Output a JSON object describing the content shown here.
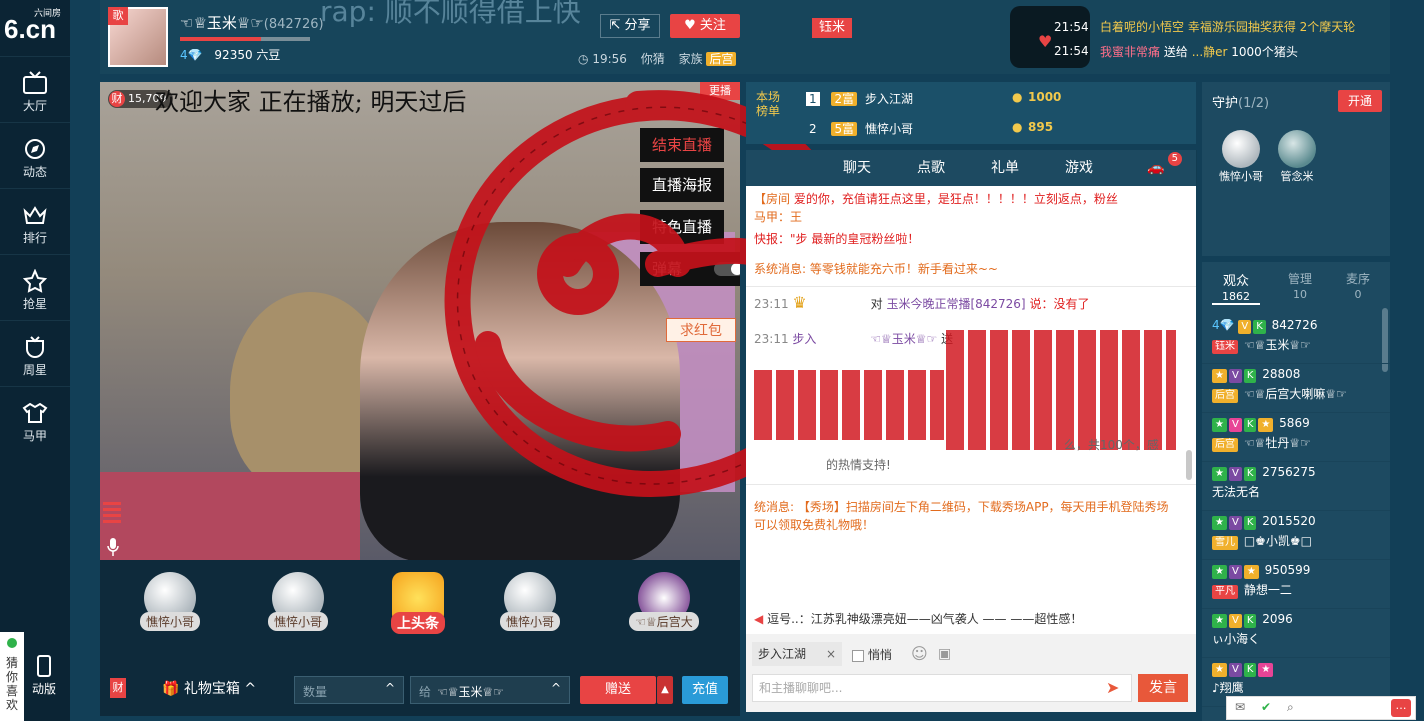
{
  "site": {
    "logo_top": "六间房",
    "logo_main": "6.cn"
  },
  "nav": [
    {
      "label": "大厅",
      "icon": "tv-icon"
    },
    {
      "label": "动态",
      "icon": "compass-icon"
    },
    {
      "label": "排行",
      "icon": "crown-icon"
    },
    {
      "label": "抢星",
      "icon": "star-icon"
    },
    {
      "label": "周星",
      "icon": "cup-icon"
    },
    {
      "label": "马甲",
      "icon": "shirt-icon"
    }
  ],
  "nav_bottom": {
    "mobile": "动版",
    "guess": "猜你喜欢"
  },
  "host": {
    "song_tag": "歌",
    "name": "☜♕玉米♕☞",
    "id": "(842726)",
    "beans": "92350 六豆",
    "level": "4",
    "share": "分享",
    "follow": "关注",
    "time": "19:56",
    "guess": "你猜",
    "family_label": "家族",
    "family_badge": "后宫"
  },
  "banner": {
    "title": "rap: 顺不顺得借上快",
    "flag": "钰米",
    "time1": "21:54",
    "time2": "21:54",
    "news1": "白着呢的小悟空 幸福游乐园抽奖获得 2个摩天轮",
    "news2_user": "我蜜非常痛",
    "news2_mid": "送给",
    "news2_target": "...静er",
    "news2_gift": "1000个猪头"
  },
  "video": {
    "viewer_tag": "财",
    "viewer_count": "15,709",
    "subtitle": "欢迎大家 正在播放; 明天过后",
    "corner": "更播",
    "menu": [
      "结束直播",
      "直播海报",
      "特色直播",
      "弹幕"
    ],
    "redpacket": "求红包"
  },
  "gifts": {
    "slots": [
      "憔悴小哥",
      "憔悴小哥",
      "上头条",
      "憔悴小哥",
      "☜♕后宫大"
    ],
    "box": "礼物宝箱",
    "qty_placeholder": "数量",
    "to_label": "给",
    "to_name": "☜♕玉米♕☞",
    "send": "赠送",
    "recharge": "充值",
    "wealth": "财"
  },
  "ranking": {
    "title": "本场榜单",
    "rows": [
      {
        "rank": "1",
        "badge": "2富",
        "name": "步入江湖",
        "coins": "1000"
      },
      {
        "rank": "2",
        "badge": "5富",
        "name": "憔悴小哥",
        "coins": "895"
      }
    ]
  },
  "tabs": [
    "",
    "聊天",
    "点歌",
    "礼单",
    "游戏"
  ],
  "tab_badge": "5",
  "chat": {
    "m1a": "【房间",
    "m1b": "爱的你，充值请狂点这里，是狂点！！！！！立刻返点，粉丝",
    "m1c": "马甲：王",
    "m2": "快报：\"步",
    "m2b": "最新的皇冠粉丝啦！",
    "m3a": "系统消息:",
    "m3b": "等零钱就能充六币！新手看过来~~",
    "m4_time": "23:11",
    "m4_to": "对",
    "m4_name": "玉米今晚正常播[842726]",
    "m4_says": "说：没有了",
    "m5_time": "23:11",
    "m5_user": "步入",
    "m5_target": "☜♕玉米♕☞",
    "m5_verb": "送",
    "m5_tail": "么，共100个，感",
    "m5_thanks": "的热情支持!",
    "m6a": "统消息:",
    "m6b": "【秀场】扫描房间左下角二维码，下载秀场APP，每天用手机登陆秀场可以领取免费礼物哦！",
    "notice": "逗号..：江苏乳神级漂亮妞——凶气袭人 —— ——超性感！",
    "reply_to": "步入江湖",
    "quiet": "悄悄",
    "input_placeholder": "和主播聊聊吧...",
    "send": "发言"
  },
  "guard": {
    "title": "守护",
    "count": "(1/2)",
    "open": "开通",
    "members": [
      "憔悴小哥",
      "管念米"
    ]
  },
  "audience_tabs": [
    {
      "label": "观众",
      "count": "1862"
    },
    {
      "label": "管理",
      "count": "10"
    },
    {
      "label": "麦序",
      "count": "0"
    }
  ],
  "audience": [
    {
      "num": "842726",
      "name": "☜♕玉米♕☞",
      "tag": "钰米"
    },
    {
      "num": "28808",
      "name": "☜♕后宫大喇嘛♕☞",
      "tag": "后宫"
    },
    {
      "num": "5869",
      "name": "☜♕牡丹♕☞",
      "tag": "后宫"
    },
    {
      "num": "2756275",
      "name": "无法无名",
      "tag": ""
    },
    {
      "num": "2015520",
      "name": "□♚小凯♚□",
      "tag": "雪儿"
    },
    {
      "num": "950599",
      "name": "静想一二",
      "tag": "平凡"
    },
    {
      "num": "2096",
      "name": "ぃ小海く",
      "tag": ""
    },
    {
      "num": "",
      "name": "♪翔鹰",
      "tag": ""
    }
  ],
  "colors": {
    "accent": "#e84444",
    "panel": "#1d4a61",
    "bg": "#123f57"
  }
}
